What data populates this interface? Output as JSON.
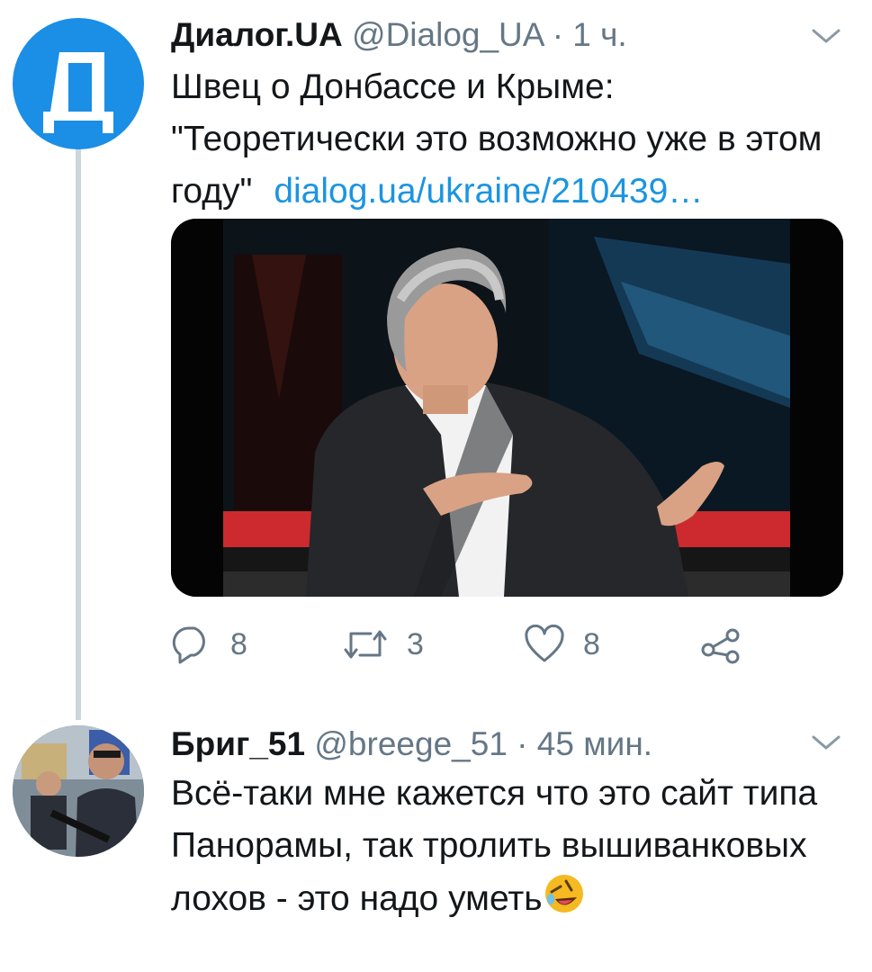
{
  "tweets": [
    {
      "author_name": "Диалог.UA",
      "handle": "@Dialog_UA",
      "time": "· 1 ч.",
      "avatar_letter": "Д",
      "text": "Швец о Донбассе и Крыме: \"Теоретически это возможно уже в этом году\"",
      "link": "dialog.ua/ukraine/210439…",
      "actions": {
        "replies": "8",
        "retweets": "3",
        "likes": "8"
      },
      "icons": [
        "reply-icon",
        "retweet-icon",
        "like-icon",
        "share-icon",
        "chevron-down-icon"
      ]
    },
    {
      "author_name": "Бриг_51",
      "handle": "@breege_51",
      "time": "· 45 мин.",
      "text": "Всё-таки мне кажется что это сайт типа Панорамы, так тролить вышиванковых лохов - это надо уметь",
      "emoji": "rolling-on-floor-laughing-emoji"
    }
  ],
  "colors": {
    "accent_link": "#1b95e0",
    "muted": "#657786",
    "thread_line": "#ccd6dd",
    "avatar_blue": "#1b8ee6"
  }
}
